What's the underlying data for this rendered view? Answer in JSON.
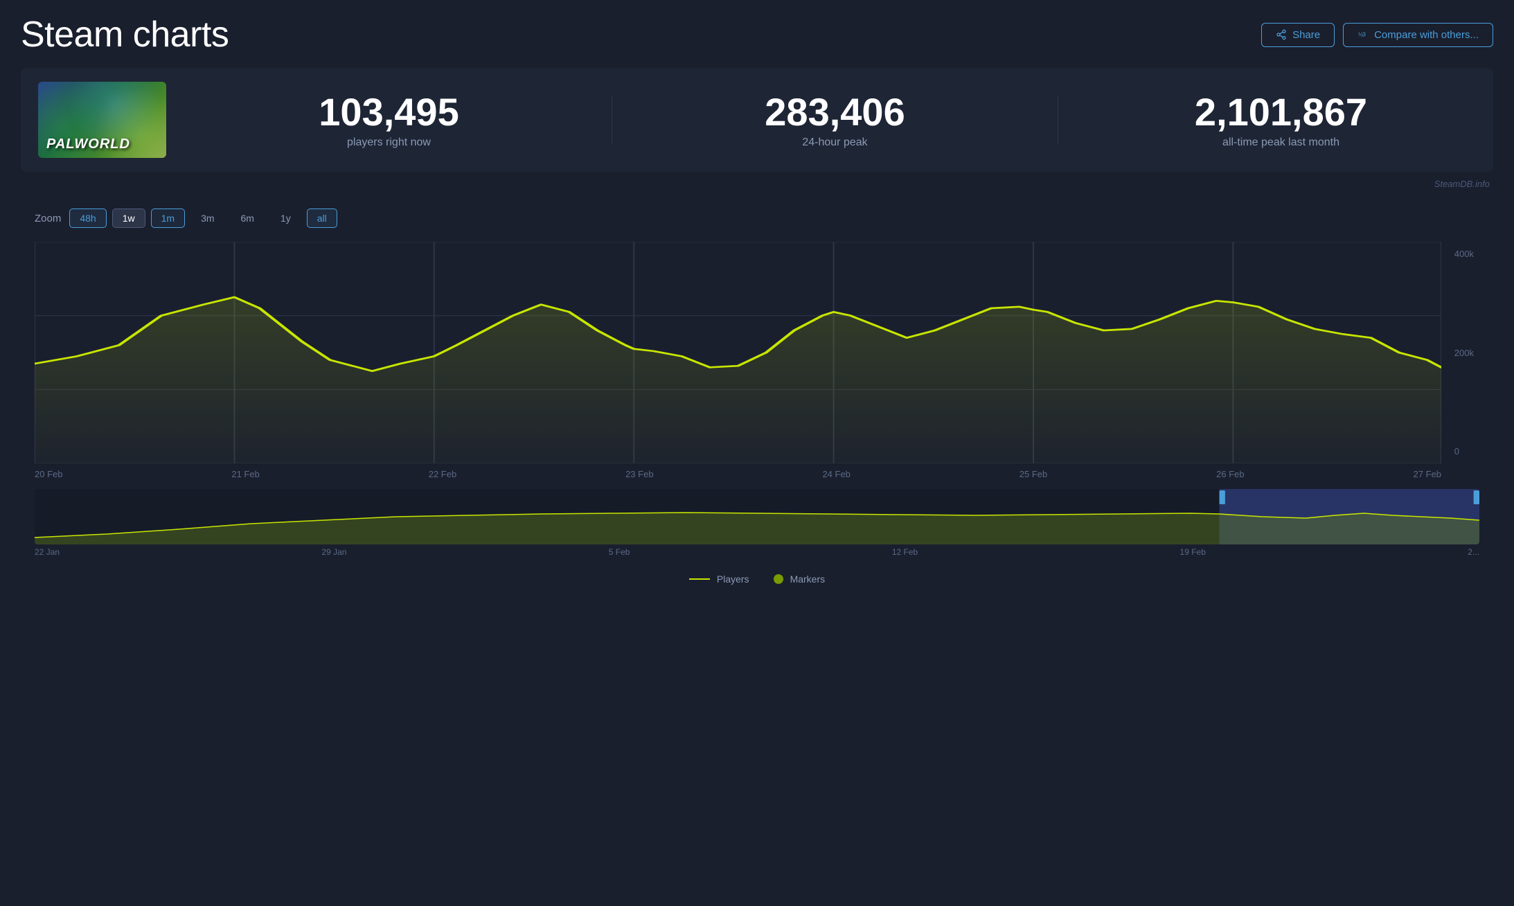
{
  "header": {
    "title": "Steam charts",
    "share_label": "Share",
    "compare_label": "Compare with others..."
  },
  "game": {
    "name": "PALWORLD",
    "thumbnail_alt": "Palworld game thumbnail"
  },
  "stats": {
    "current_players": "103,495",
    "current_players_label": "players right now",
    "peak_24h": "283,406",
    "peak_24h_label": "24-hour peak",
    "all_time_peak": "2,101,867",
    "all_time_peak_label": "all-time peak last month"
  },
  "credit": "SteamDB.info",
  "zoom": {
    "label": "Zoom",
    "options": [
      "48h",
      "1w",
      "1m",
      "3m",
      "6m",
      "1y",
      "all"
    ],
    "active": "1w"
  },
  "chart": {
    "y_labels": [
      "400k",
      "200k",
      "0"
    ],
    "x_labels": [
      "20 Feb",
      "21 Feb",
      "22 Feb",
      "23 Feb",
      "24 Feb",
      "25 Feb",
      "26 Feb",
      "27 Feb"
    ]
  },
  "mini_chart": {
    "x_labels": [
      "22 Jan",
      "29 Jan",
      "5 Feb",
      "12 Feb",
      "19 Feb",
      "2..."
    ]
  },
  "legend": {
    "players_label": "Players",
    "markers_label": "Markers"
  }
}
